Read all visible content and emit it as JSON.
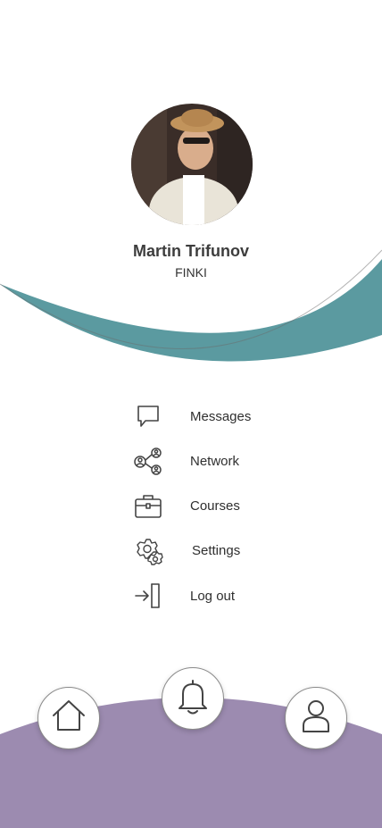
{
  "profile": {
    "name": "Martin Trifunov",
    "organization": "FINKI"
  },
  "menu": [
    {
      "label": "Messages",
      "icon": "chat-bubble-icon"
    },
    {
      "label": "Network",
      "icon": "network-icon"
    },
    {
      "label": "Courses",
      "icon": "briefcase-icon"
    },
    {
      "label": "Settings",
      "icon": "gear-icon"
    },
    {
      "label": "Log out",
      "icon": "logout-icon"
    }
  ],
  "bottom_nav": [
    {
      "name": "home",
      "icon": "home-icon"
    },
    {
      "name": "notifications",
      "icon": "bell-icon"
    },
    {
      "name": "profile",
      "icon": "user-icon"
    }
  ],
  "colors": {
    "header_arc": "#5b9aa0",
    "bottom_wave": "#9c8bb0",
    "background": "#ffffff"
  }
}
